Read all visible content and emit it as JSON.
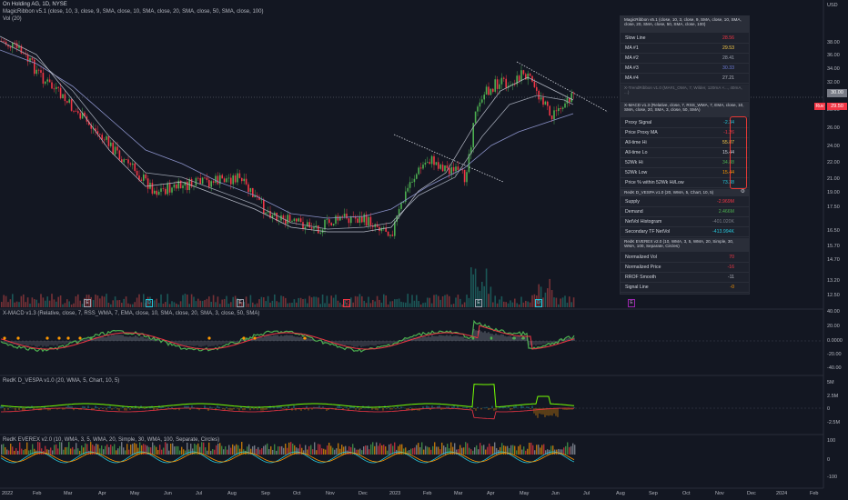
{
  "header": {
    "symbol_line": "On Holding AG, 1D, NYSE",
    "study_line_1": "MagicRibbon v5.1 (close, 10, 3, close, 9, SMA, close, 10, SMA, close, 20, SMA, close, 50, SMA, close, 100)",
    "study_line_2": "Vol (20)"
  },
  "price_axis": {
    "currency": "USD",
    "labels": [
      "38.00",
      "36.00",
      "34.00",
      "32.00",
      "30.00",
      "28.00",
      "26.00",
      "24.00",
      "22.00",
      "21.00",
      "19.00",
      "17.50",
      "16.50",
      "15.70",
      "14.70",
      "13.20",
      "12.50"
    ],
    "current_price": "30.00",
    "ruv_badge": "Ruv",
    "ruv_value": "29.50"
  },
  "panes": {
    "macd": {
      "title": "X-MACD v1.3 (Relative, close, 7, RSS_WMA, 7, EMA, close, 10, SMA, close, 20, SMA, 3, close, 50, SMA)",
      "labels": [
        "40.00",
        "20.00",
        "0.0000",
        "-20.00",
        "-40.00"
      ]
    },
    "vespa": {
      "title": "RedK D_VESPA v1.0 (20, WMA, 5, Chart, 10, 5)",
      "labels": [
        "5M",
        "2.5M",
        "0",
        "-2.5M"
      ]
    },
    "everex": {
      "title": "RedK EVEREX v2.0 (10, WMA, 3, 5, WMA, 20, Simple, 30, WMA, 100, Separate, Circles)",
      "labels": [
        "100",
        "0",
        "-100"
      ]
    }
  },
  "time_axis": [
    "2022",
    "Feb",
    "Mar",
    "Apr",
    "May",
    "Jun",
    "Jul",
    "Aug",
    "Sep",
    "Oct",
    "Nov",
    "Dec",
    "2023",
    "Feb",
    "Mar",
    "Apr",
    "May",
    "Jun",
    "Jul",
    "Aug",
    "Sep",
    "Oct",
    "Nov",
    "Dec",
    "2024",
    "Feb"
  ],
  "data_window": {
    "ribbon_header": "MagicRibbon v5.1 (close, 10, 3, close, 9, SMA, close, 10, SMA, close, 20, SMA, close, 50, SMA, close, 100)",
    "ribbon_rows": [
      {
        "label": "Slow Line",
        "value": "28.56",
        "color": "#f23645"
      },
      {
        "label": "MA #1",
        "value": "29.53",
        "color": "#f7c948"
      },
      {
        "label": "MA #2",
        "value": "28.41",
        "color": "#9aa0ad"
      },
      {
        "label": "MA #3",
        "value": "30.33",
        "color": "#6a78d1"
      },
      {
        "label": "MA #4",
        "value": "27.21",
        "color": "#b2b5be"
      }
    ],
    "trend_header": "X-TrendRibbon v1.0 (MA#1_OMA, 7, Wilder, 120mA ×..., 40mA, ...)",
    "macd_header": "X-MACD v1.3 (Relative, close, 7, RSS_WMA, 7, EMA, close, 10, SMA, close, 20, SMA, 3, close, 50, SMA)",
    "macd_rows": [
      {
        "label": "Proxy Signal",
        "value": "-2.34",
        "color": "#26c6da"
      },
      {
        "label": "Price Proxy MA",
        "value": "-1.26",
        "color": "#f23645"
      },
      {
        "label": "All-time Hi",
        "value": "55.87",
        "color": "#f7c948"
      },
      {
        "label": "All-time Lo",
        "value": "15.44",
        "color": "#d1d4dc"
      },
      {
        "label": "52Wk Hi",
        "value": "34.88",
        "color": "#4caf50"
      },
      {
        "label": "52Wk Low",
        "value": "15.44",
        "color": "#ff9800"
      },
      {
        "label": "Price % within 52Wk Hi/Low",
        "value": "73.38",
        "color": "#26c6da"
      }
    ],
    "vespa_header": "RedK D_VESPA v1.0 (20, WMA, 5, Chart, 10, 5)",
    "vespa_rows": [
      {
        "label": "Supply",
        "value": "-2.969M",
        "color": "#f23645"
      },
      {
        "label": "Demand",
        "value": "2.466M",
        "color": "#4caf50"
      },
      {
        "label": "NetVol Histogram",
        "value": "-401.020K",
        "color": "#787b86"
      },
      {
        "label": "Secondary TF NetVol",
        "value": "-413.994K",
        "color": "#26c6da"
      }
    ],
    "everex_header": "RedK EVEREX v2.0 (10, WMA, 3, 5, WMA, 20, Simple, 30, WMA, 100, Separate, Circles)",
    "everex_rows": [
      {
        "label": "Normalized Vol",
        "value": "70",
        "color": "#f23645"
      },
      {
        "label": "Normalized Price",
        "value": "-16",
        "color": "#f23645"
      },
      {
        "label": "RROF Smooth",
        "value": "-11",
        "color": "#b2b5be"
      },
      {
        "label": "Signal Line",
        "value": "-0",
        "color": "#ff9800"
      }
    ]
  },
  "event_badges": [
    "E",
    "D",
    "E",
    "D",
    "E",
    "D",
    "E"
  ]
}
